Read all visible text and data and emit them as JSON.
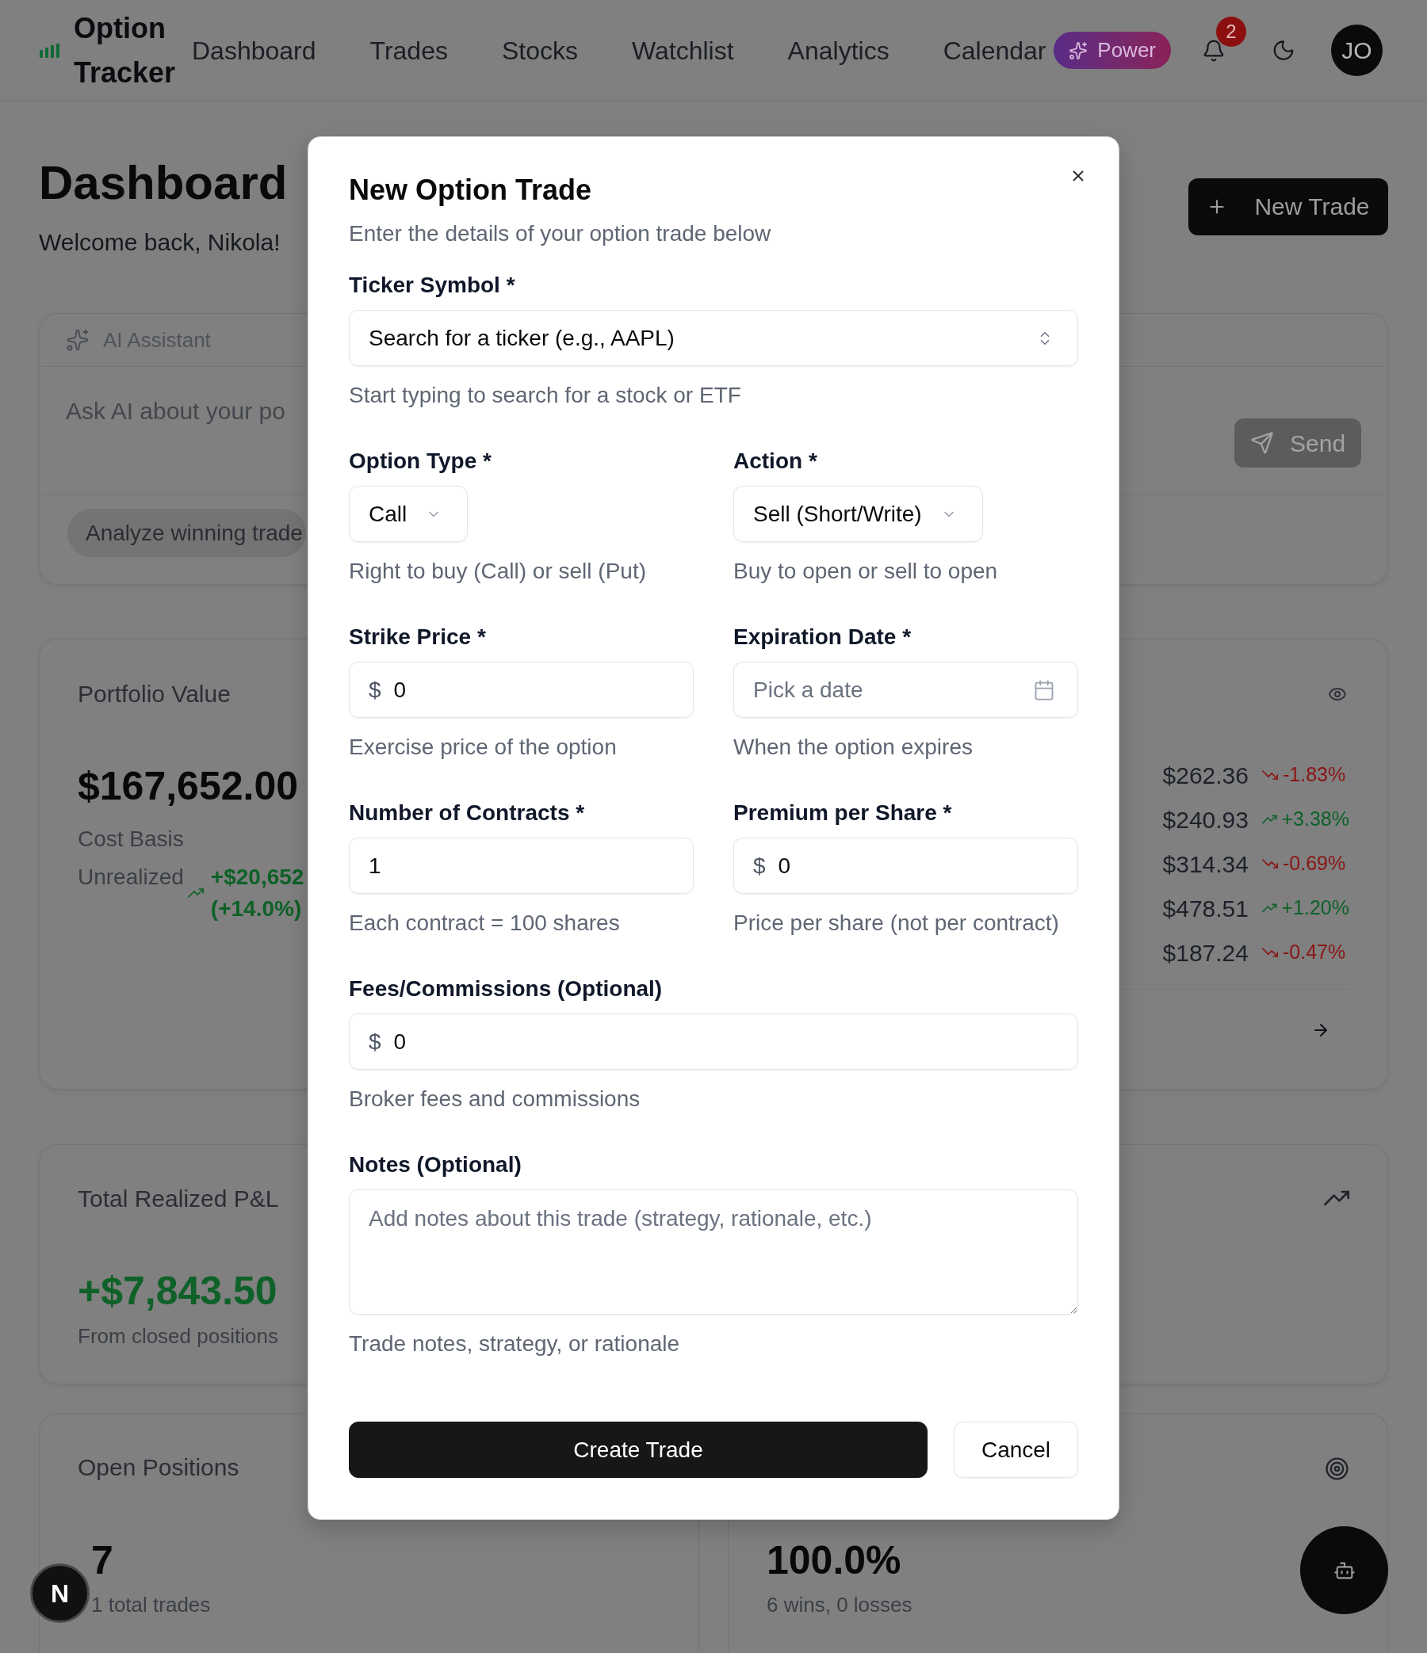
{
  "header": {
    "app_name": "Option Tracker",
    "nav": [
      "Dashboard",
      "Trades",
      "Stocks",
      "Watchlist",
      "Analytics",
      "Calendar"
    ],
    "power_badge": "Power",
    "notification_count": "2",
    "avatar_initials": "JO"
  },
  "page": {
    "title": "Dashboard",
    "subtitle": "Welcome back, Nikola!",
    "new_trade_button": "New Trade"
  },
  "ai_assistant": {
    "title": "AI Assistant",
    "prompt": {
      "placeholder": "Ask AI about your po"
    },
    "send_button": "Send",
    "suggestions": [
      "Analyze winning trade"
    ]
  },
  "portfolio": {
    "title": "Portfolio Value",
    "value": "$167,652.00",
    "cost_basis_label": "Cost Basis",
    "unrealized_label": "Unrealized",
    "unrealized_amount": "+$20,652",
    "unrealized_percent": "(+14.0%)"
  },
  "quotes": [
    {
      "price": "$262.36",
      "change": "-1.83%",
      "kind": "down"
    },
    {
      "price": "$240.93",
      "change": "+3.38%",
      "kind": "up"
    },
    {
      "price": "$314.34",
      "change": "-0.69%",
      "kind": "down"
    },
    {
      "price": "$478.51",
      "change": "+1.20%",
      "kind": "up"
    },
    {
      "price": "$187.24",
      "change": "-0.47%",
      "kind": "down"
    }
  ],
  "realized_pnl": {
    "title": "Total Realized P&L",
    "value": "+$7,843.50",
    "note": "From closed positions"
  },
  "open_positions": {
    "title": "Open Positions",
    "value": "7",
    "note": "1 total trades"
  },
  "win_rate": {
    "value": "100.0%",
    "note": "6 wins, 0 losses"
  },
  "dialog": {
    "title": "New Option Trade",
    "description": "Enter the details of your option trade below",
    "rows": [
      {
        "fields": [
          {
            "kind": "combobox",
            "label": "Ticker Symbol *",
            "value": "Search for a ticker (e.g., AAPL)",
            "hint": "Start typing to search for a stock or ETF"
          }
        ]
      },
      {
        "fields": [
          {
            "kind": "select",
            "label": "Option Type *",
            "value": "Call",
            "hint": "Right to buy (Call) or sell (Put)"
          },
          {
            "kind": "select",
            "label": "Action *",
            "value": "Sell (Short/Write)",
            "hint": "Buy to open or sell to open"
          }
        ]
      },
      {
        "fields": [
          {
            "kind": "currency",
            "label": "Strike Price *",
            "prefix": "$",
            "value": "0",
            "hint": "Exercise price of the option"
          },
          {
            "kind": "date",
            "label": "Expiration Date *",
            "placeholder": "Pick a date",
            "hint": "When the option expires"
          }
        ]
      },
      {
        "fields": [
          {
            "kind": "number",
            "label": "Number of Contracts *",
            "value": "1",
            "hint": "Each contract = 100 shares"
          },
          {
            "kind": "currency",
            "label": "Premium per Share *",
            "prefix": "$",
            "value": "0",
            "hint": "Price per share (not per contract)"
          }
        ]
      },
      {
        "fields": [
          {
            "kind": "currency",
            "label": "Fees/Commissions (Optional)",
            "prefix": "$",
            "value": "0",
            "hint": "Broker fees and commissions"
          }
        ]
      },
      {
        "fields": [
          {
            "kind": "textarea",
            "label": "Notes (Optional)",
            "placeholder": "Add notes about this trade (strategy, rationale, etc.)",
            "hint": "Trade notes, strategy, or rationale"
          }
        ]
      }
    ],
    "buttons": [
      {
        "label": "Create Trade",
        "kind": "primary"
      },
      {
        "label": "Cancel",
        "kind": "secondary"
      }
    ]
  },
  "dev_badge": {
    "label": "N"
  }
}
